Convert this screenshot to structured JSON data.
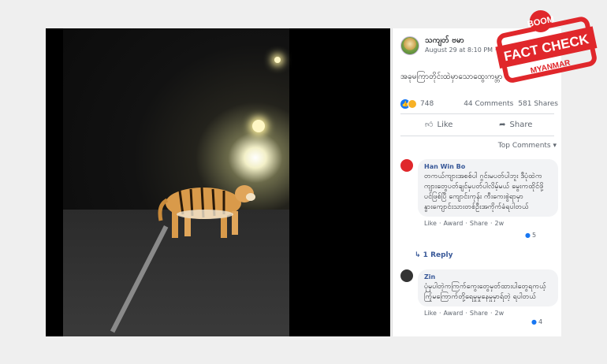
{
  "post": {
    "author": "သကျတ် ဗမာ",
    "date": "August 29 at 8:10 PM · ",
    "text": "အခုမကြာတိုင်းထဲမှာသောထွေးကမ္ဘာ",
    "reaction_count": "748",
    "comments_count": "44 Comments",
    "shares_count": "581 Shares",
    "like_label": "Like",
    "share_label": "Share",
    "sort_label": "Top Comments ▾"
  },
  "comments": [
    {
      "name": "Han Win Bo",
      "text": "တကယ်ကျားအစစ်ပါ ဂွင်းမပတ်ပါဘူး ဒီပုံထဲကကျားတွေပတ်ချင်မှပတ်ပါလိမ့်မယ် မွေးကထိုင်ဖို့ ပင်ဖြစ်ပြီ ကျောင်းကုန်း ကီးကေးစွဲရာမှာ နွားကျောင်းသားတစ်ဦးအကိုက်ခံရပါတယ်",
      "meta": [
        "Like",
        "·",
        "Award",
        "·",
        "Share",
        "·",
        "2w"
      ],
      "react_count": "5",
      "reply": "↳ 1 Reply"
    },
    {
      "name": "Zin",
      "text": "ပုံမှပါတဲ့ကကြက်ကွေးတွေမှတ်ထားပါတွေရကယ့်ကြုံမကြောက်တို့ရေမှုမှုနေမှုမှာရ်တဲ့ ရပါတယ်",
      "meta": [
        "Like",
        "·",
        "Award",
        "·",
        "Share",
        "·",
        "2w"
      ],
      "react_count": "4"
    }
  ],
  "stamp": {
    "brand": "BOOM",
    "title": "FACT CHECK",
    "subtitle": "MYANMAR"
  },
  "colors": {
    "stamp_red": "#e0272b",
    "fb_blue": "#1877f2",
    "link": "#385898"
  }
}
